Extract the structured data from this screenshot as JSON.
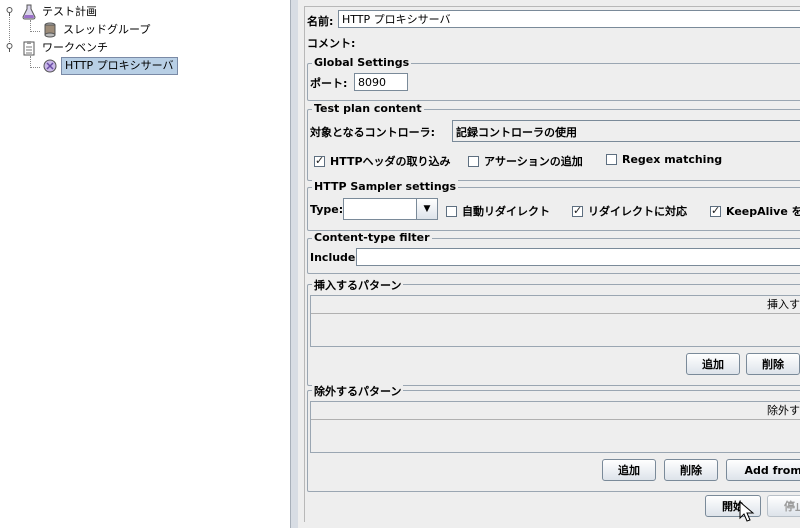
{
  "tree": {
    "test_plan": "テスト計画",
    "thread_group": "スレッドグループ",
    "workbench": "ワークベンチ",
    "http_proxy": "HTTP プロキシサーバ"
  },
  "form": {
    "name_label": "名前:",
    "name_value": "HTTP プロキシサーバ",
    "comment_label": "コメント:"
  },
  "global_settings": {
    "title": "Global Settings",
    "port_label": "ポート:",
    "port_value": "8090"
  },
  "test_plan_content": {
    "title": "Test plan content",
    "target_label": "対象となるコントローラ:",
    "target_value": "記録コントローラの使用",
    "checkboxes": [
      {
        "label": "HTTPヘッダの取り込み",
        "checked": true
      },
      {
        "label": "アサーションの追加",
        "checked": false
      },
      {
        "label": "Regex matching",
        "checked": false
      }
    ]
  },
  "sampler_settings": {
    "title": "HTTP Sampler settings",
    "type_label": "Type:",
    "type_value": "",
    "checkboxes": [
      {
        "label": "自動リダイレクト",
        "checked": false
      },
      {
        "label": "リダイレクトに対応",
        "checked": true
      },
      {
        "label": "KeepAlive を有",
        "checked": true
      }
    ]
  },
  "content_filter": {
    "title": "Content-type filter",
    "include_label": "Include:",
    "include_value": ""
  },
  "include_patterns": {
    "title": "挿入するパターン",
    "column": "挿入す",
    "add": "追加",
    "delete": "削除"
  },
  "exclude_patterns": {
    "title": "除外するパターン",
    "column": "除外す",
    "add": "追加",
    "delete": "削除",
    "add_from_clipboard": "Add from Cl"
  },
  "actions": {
    "start": "開始",
    "stop": "停止"
  }
}
